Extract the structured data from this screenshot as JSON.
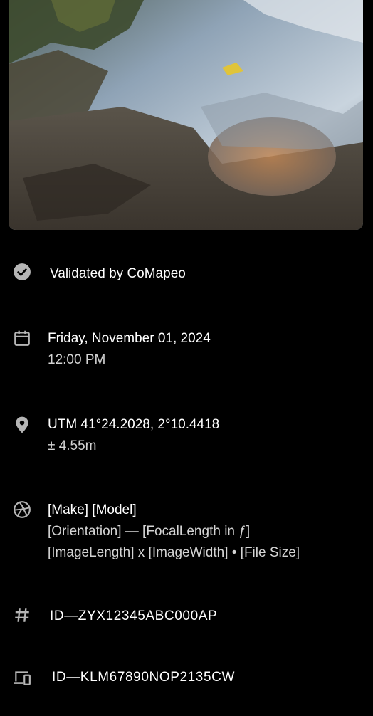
{
  "photo": {
    "icon": "landscape-photo",
    "colors": {
      "sky": "#9fb3c6",
      "water": "#6f7f89",
      "mud": "#4b453d",
      "puddle": "#b07a4e"
    }
  },
  "details": {
    "validation": {
      "icon": "check-circle-icon",
      "text": "Validated by CoMapeo"
    },
    "date": {
      "icon": "calendar-icon",
      "line1": "Friday,  November 01, 2024",
      "line2": "12:00 PM"
    },
    "location": {
      "icon": "location-pin-icon",
      "line1": "UTM   41°24.2028, 2°10.4418",
      "line2": "± 4.55m"
    },
    "camera": {
      "icon": "camera-aperture-icon",
      "line1": "[Make] [Model]",
      "line2": "[Orientation] — [FocalLength in ƒ]",
      "line3": "[ImageLength] x [ImageWidth] • [File Size]"
    },
    "observation_id": {
      "icon": "hash-icon",
      "text": "ID—ZYX12345ABC000AP"
    },
    "device_id": {
      "icon": "devices-icon",
      "text": "ID—KLM67890NOP2135CW"
    }
  },
  "colors": {
    "text": "#ffffff",
    "icon": "#b5b5b5",
    "background": "#000000"
  }
}
